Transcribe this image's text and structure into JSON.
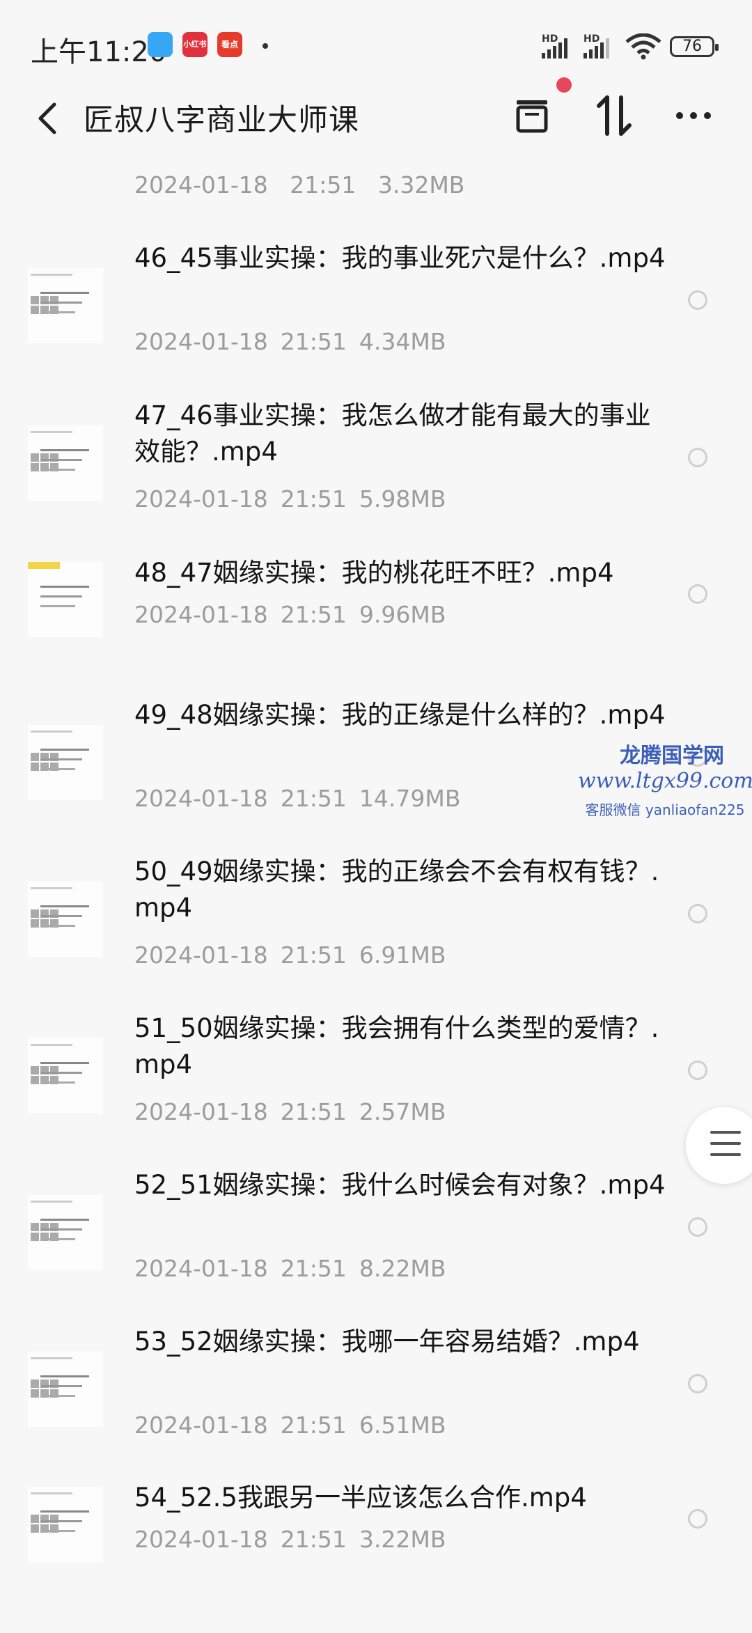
{
  "status_bar": {
    "time": "上午11:20",
    "apps": [
      {
        "name": "",
        "color": "#35a7f5"
      },
      {
        "name": "小红书",
        "color": "#e0313d"
      },
      {
        "name": "看点",
        "color": "#e83a2a"
      }
    ],
    "hd1": "HD",
    "hd2": "HD",
    "battery": "76"
  },
  "header": {
    "title": "匠叔八字商业大师课"
  },
  "partial_item": {
    "date": "2024-01-18",
    "time": "21:51",
    "size": "3.32MB"
  },
  "items": [
    {
      "name": "46_45事业实操：我的事业死穴是什么？.mp4",
      "date": "2024-01-18",
      "time": "21:51",
      "size": "4.34MB"
    },
    {
      "name": "47_46事业实操：我怎么做才能有最大的事业效能？.mp4",
      "date": "2024-01-18",
      "time": "21:51",
      "size": "5.98MB"
    },
    {
      "name": "48_47姻缘实操：我的桃花旺不旺？.mp4",
      "date": "2024-01-18",
      "time": "21:51",
      "size": "9.96MB"
    },
    {
      "name": "49_48姻缘实操：我的正缘是什么样的？.mp4",
      "date": "2024-01-18",
      "time": "21:51",
      "size": "14.79MB"
    },
    {
      "name": "50_49姻缘实操：我的正缘会不会有权有钱？.mp4",
      "date": "2024-01-18",
      "time": "21:51",
      "size": "6.91MB"
    },
    {
      "name": "51_50姻缘实操：我会拥有什么类型的爱情？.mp4",
      "date": "2024-01-18",
      "time": "21:51",
      "size": "2.57MB"
    },
    {
      "name": "52_51姻缘实操：我什么时候会有对象？.mp4",
      "date": "2024-01-18",
      "time": "21:51",
      "size": "8.22MB"
    },
    {
      "name": "53_52姻缘实操：我哪一年容易结婚？.mp4",
      "date": "2024-01-18",
      "time": "21:51",
      "size": "6.51MB"
    },
    {
      "name": "54_52.5我跟另一半应该怎么合作.mp4",
      "date": "2024-01-18",
      "time": "21:51",
      "size": "3.22MB"
    }
  ],
  "watermark": {
    "line1": "龙腾国学网",
    "line2": "www.ltgx99.com",
    "line3": "客服微信 yanliaofan225"
  }
}
